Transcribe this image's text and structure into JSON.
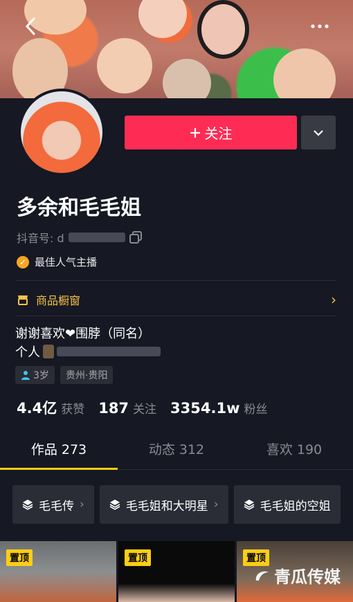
{
  "header": {
    "back_icon": "chevron-left-icon",
    "more_icon": "ellipsis-icon"
  },
  "profile": {
    "name": "多余和毛毛姐",
    "douyin_id_label": "抖音号: d",
    "badge": "最佳人气主播",
    "follow_label": "关注",
    "shop_window": "商品橱窗",
    "bio_line1": "谢谢喜欢❤围脖（同名）",
    "bio_line2_prefix": "个人",
    "tags": [
      "3岁",
      "贵州·贵阳"
    ]
  },
  "stats": [
    {
      "value": "4.4亿",
      "label": "获赞"
    },
    {
      "value": "187",
      "label": "关注"
    },
    {
      "value": "3354.1w",
      "label": "粉丝"
    }
  ],
  "tabs": [
    {
      "label": "作品 273",
      "active": true
    },
    {
      "label": "动态 312",
      "active": false
    },
    {
      "label": "喜欢 190",
      "active": false
    }
  ],
  "collections": [
    "毛毛传",
    "毛毛姐和大明星",
    "毛毛姐的空姐"
  ],
  "thumbnails": [
    {
      "pin": "置顶"
    },
    {
      "pin": "置顶"
    },
    {
      "pin": "置顶"
    }
  ],
  "watermark": "青瓜传媒",
  "colors": {
    "accent": "#fe2c55",
    "pin": "#face15",
    "shop": "#f6c445"
  }
}
